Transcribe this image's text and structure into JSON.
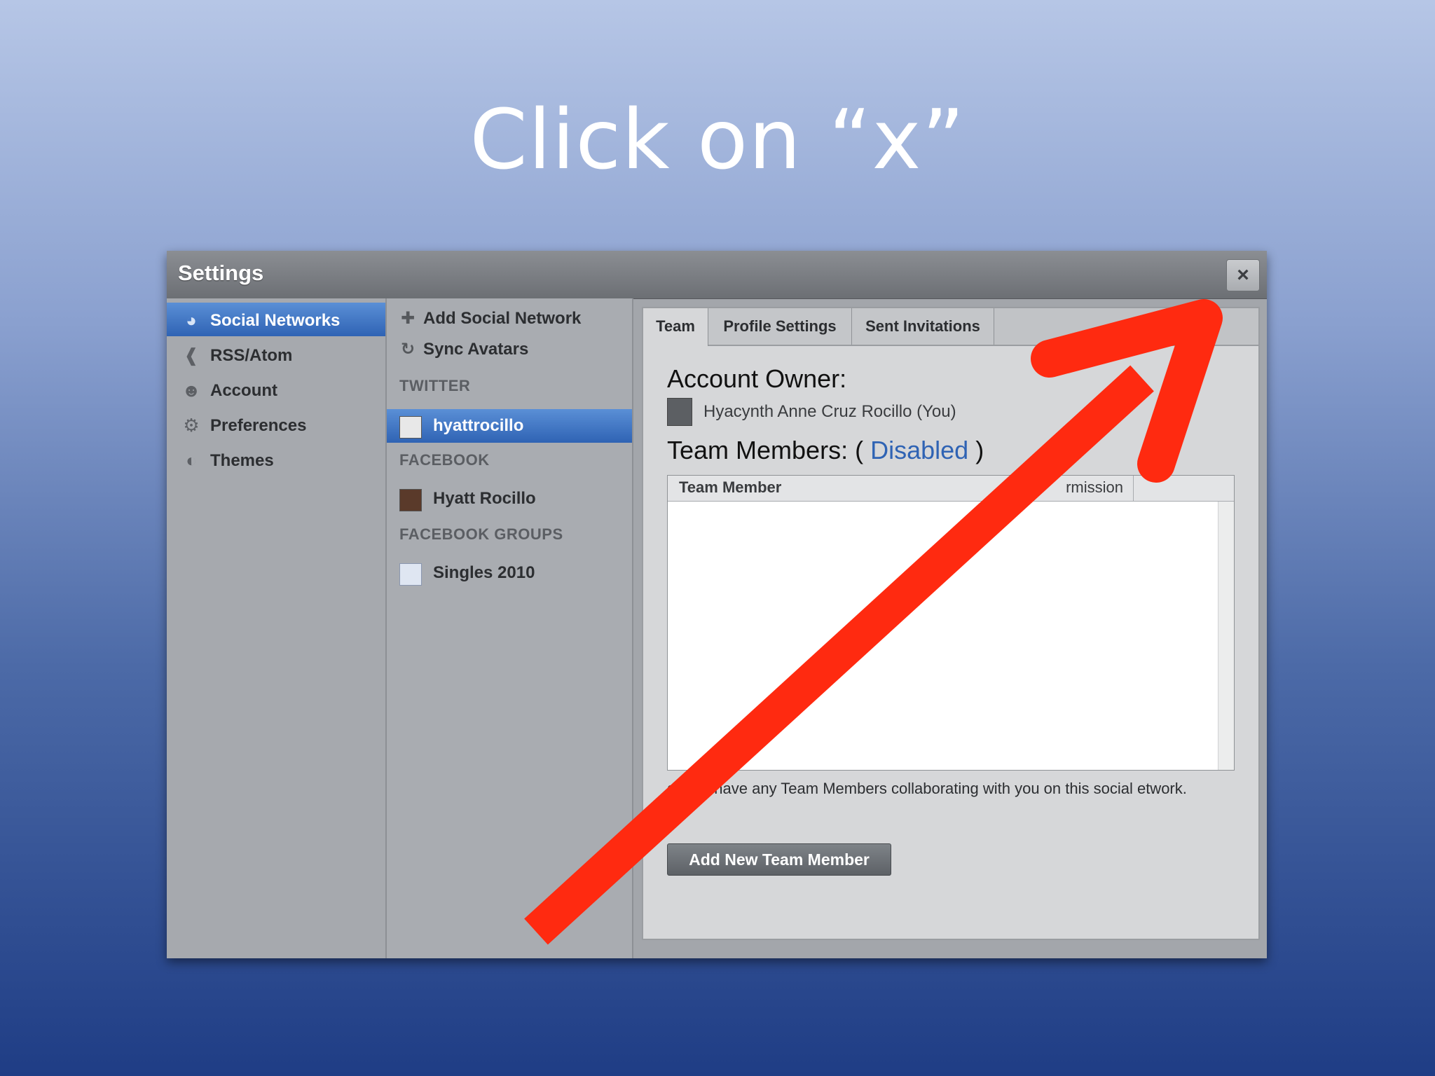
{
  "slide": {
    "title": "Click on “x”"
  },
  "window": {
    "title": "Settings",
    "close_label": "×"
  },
  "nav": {
    "items": [
      {
        "label": "Social Networks",
        "icon": "globe-icon",
        "active": true
      },
      {
        "label": "RSS/Atom",
        "icon": "rss-icon",
        "active": false
      },
      {
        "label": "Account",
        "icon": "user-icon",
        "active": false
      },
      {
        "label": "Preferences",
        "icon": "gear-icon",
        "active": false
      },
      {
        "label": "Themes",
        "icon": "palette-icon",
        "active": false
      }
    ]
  },
  "networks": {
    "add_label": "Add Social Network",
    "sync_label": "Sync Avatars",
    "twitter_section": "TWITTER",
    "twitter_account": "hyattrocillo",
    "facebook_section": "FACEBOOK",
    "facebook_account": "Hyatt Rocillo",
    "groups_section": "FACEBOOK GROUPS",
    "group_account": "Singles 2010"
  },
  "tabs": [
    "Team",
    "Profile Settings",
    "Sent Invitations"
  ],
  "team": {
    "owner_heading": "Account Owner:",
    "owner_name": "Hyacynth Anne Cruz Rocillo (You)",
    "members_heading": "Team Members: (",
    "members_status": "Disabled",
    "members_close": ")",
    "col_member": "Team Member",
    "col_permission": "rmission",
    "empty_note": "do not have any Team Members collaborating with you on this social etwork.",
    "add_button": "Add New Team Member"
  },
  "colors": {
    "arrow": "#ff2a10",
    "selection": "#3a6fc0",
    "link": "#2f63b4"
  }
}
